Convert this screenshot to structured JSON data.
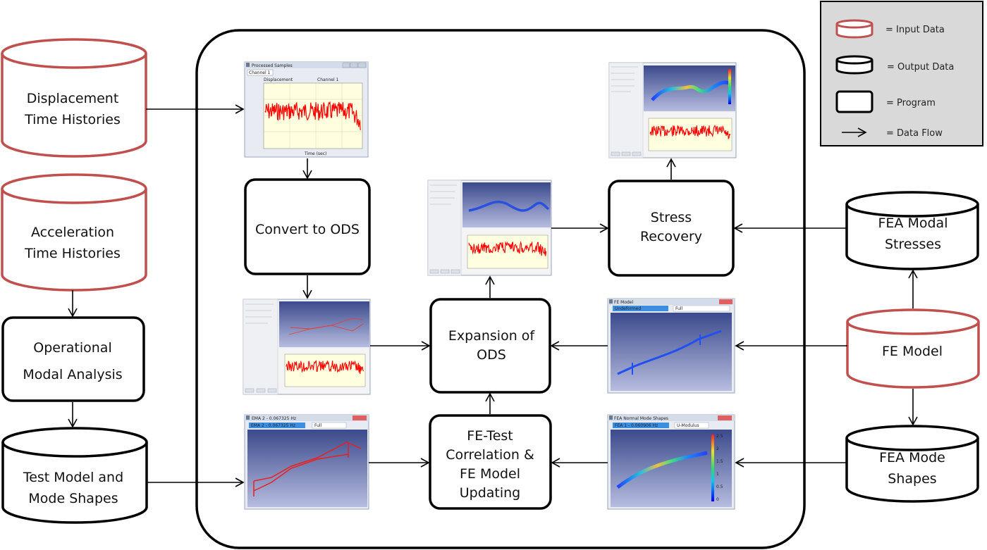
{
  "legend": {
    "items": [
      {
        "symbol": "red-cylinder",
        "label": "= Input Data"
      },
      {
        "symbol": "black-cylinder",
        "label": "= Output Data"
      },
      {
        "symbol": "rounded-rectangle",
        "label": "= Program"
      },
      {
        "symbol": "arrow",
        "label": "= Data Flow"
      }
    ]
  },
  "inputs": {
    "displacement": [
      "Displacement",
      "Time Histories"
    ],
    "acceleration": [
      "Acceleration",
      "Time Histories"
    ],
    "fe_model": [
      "FE Model"
    ]
  },
  "outputs": {
    "test_model": [
      "Test Model and",
      "Mode Shapes"
    ],
    "fea_modal_stresses": [
      "FEA Modal",
      "Stresses"
    ],
    "fea_mode_shapes": [
      "FEA Mode",
      "Shapes"
    ]
  },
  "programs": {
    "oma": [
      "Operational",
      "Modal Analysis"
    ],
    "convert": [
      "Convert to ODS"
    ],
    "expansion": [
      "Expansion of",
      "ODS"
    ],
    "stress_recovery": [
      "Stress",
      "Recovery"
    ],
    "correlation": [
      "FE-Test",
      "Correlation &",
      "FE Model",
      "Updating"
    ]
  },
  "screenshots": {
    "processed_samples": {
      "title": "Processed Samples",
      "dropdown": "Channel 1",
      "plot_title": "Displacement",
      "legend": "Channel 1",
      "xlabel": "Time (sec)"
    },
    "ema": {
      "title": "EMA 2 - 0.067325 Hz",
      "dropdown1": "EMA 2 - 0.067325 Hz",
      "dropdown2": "Full"
    },
    "fea_normal_modes": {
      "title": "FEA Normal Mode Shapes",
      "dropdown1": "FEA 1 - 0.060906 Hz",
      "dropdown2": "U-Modulus",
      "colorbar_ticks": [
        "2.5",
        "2",
        "1.5",
        "1",
        "0.5",
        "0"
      ]
    },
    "fe_model": {
      "title": "FE Model",
      "dropdown1": "Undeformed",
      "dropdown2": "Full"
    }
  },
  "colors": {
    "input_stroke": "#c0504d",
    "output_stroke": "#000000",
    "legend_bg": "#d9d9d9",
    "signal": "#ff0000",
    "plot_bg": "#ffffe0",
    "viewport_top": "#3b4a8c",
    "viewport_bottom": "#b7bde0"
  }
}
